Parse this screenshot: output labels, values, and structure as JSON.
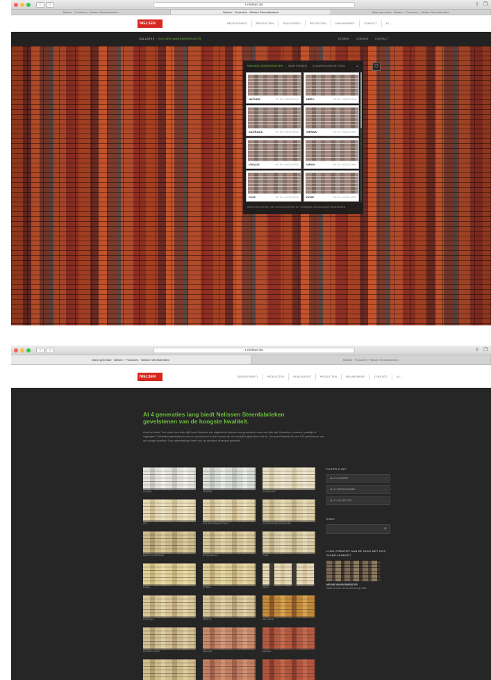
{
  "window1": {
    "url": "r-nielsen.be",
    "tabs": [
      {
        "label": "Nielsen · Producten · Nielsen Steenfabrieken",
        "active": false
      },
      {
        "label": "Nielsen · Producten · Nielsen Steenfabrieken",
        "active": true
      },
      {
        "label": "Wand generator · Nielsen · Producten · Nielsen Steenfabrieken",
        "active": false
      }
    ],
    "logo": "NIELSEN",
    "nav": [
      "BEDRIJFSINFO",
      "PRODUCTEN",
      "REALISATIES",
      "PROJECTEN",
      "NIEUWSBRIEF",
      "CONTACT",
      "NL ⌄"
    ],
    "breadcrumb": {
      "root": "CALLATEX",
      "current": "NIELSEN WANDGENERATOR"
    },
    "subnav": [
      "STENEN",
      "VOEGEN",
      "CONTACT"
    ],
    "panel": {
      "tabs": [
        "NIELSEN STEENSOORTEN",
        "MIJN STENEN",
        "KLEUREN VAN DE VOEG"
      ],
      "cards": [
        {
          "name": "NATURA",
          "code": "WF 65 / HANDVORM"
        },
        {
          "name": "NERO",
          "code": "WF 65 / HANDVORM"
        },
        {
          "name": "SAGRADA",
          "code": "WF 65 / HANDVORM"
        },
        {
          "name": "SIENNA",
          "code": "WF 65 / HANDVORM"
        },
        {
          "name": "VIVALDI",
          "code": "WF 65 / HANDVORM"
        },
        {
          "name": "VIRGO",
          "code": "WF 65 / HANDVORM"
        },
        {
          "name": "FAYE",
          "code": "WF 65 / HANDVORM"
        },
        {
          "name": "ROSE",
          "code": "WF 65 / HANDVORM"
        }
      ],
      "footer_prefix": "●",
      "footer_text": "KIES EEN STEEN, DE VOEGKLEUR EN HET VERBAND OM UW MUUR TE BEKIJKEN"
    }
  },
  "window2": {
    "url": "r-nielsen.be",
    "tabs": [
      {
        "label": "Wand generator · Nielsen · Producten · Nielsen Steenfabrieken",
        "active": true
      },
      {
        "label": "Nielsen · Producten · Nielsen Steenfabrieken",
        "active": false
      }
    ],
    "logo": "NIELSEN",
    "nav": [
      "BEDRIJFSINFO",
      "PRODUCTEN",
      "REALISATIES",
      "PROJECTEN",
      "NIEUWSBRIEF",
      "CONTACT",
      "NL ⌄"
    ],
    "hero_title": "Al 4 generaties lang biedt Nelissen Steenfabrieken gevelstenen van de hoogste kwaliteit.",
    "intro": "Kiest het beste Tool steen voor elke stijl! Vrank Nelissen stel uitgebreide stukken van gevelstenen aan voor elke stijl. Klassieke, moderne, pastelijk of ingetogen? Ontdekken gevelstenen van ons assortiment en een klasse zijn ons bedrijf te gebruiken met de. Ons pand bestaat uit ruim 100 gevelstenen van de hoogste kwaliteit. Onze steenbakkerij heeft zich als architect al bekend gebracht.",
    "products": [
      {
        "name": "ALASKA",
        "c1": "#e6e4dc",
        "c2": "#c9cbc3",
        "c3": "#f2f1ec"
      },
      {
        "name": "ARANDA",
        "c1": "#dcdfd8",
        "c2": "#c3c8c1",
        "c3": "#eceeea"
      },
      {
        "name": "ALASKA WIT",
        "c1": "#e9dec4",
        "c2": "#d6c8a6",
        "c3": "#f0e6cf"
      },
      {
        "name": "AZZ",
        "c1": "#e6d9b3",
        "c2": "#d0c094",
        "c3": "#efe4c2"
      },
      {
        "name": "AZZ GESTRAALDE WALS",
        "c1": "#e2d4ac",
        "c2": "#cbb889",
        "c3": "#ede1bd"
      },
      {
        "name": "AZZ GESTRAALDE BLAUW",
        "c1": "#ddd0a8",
        "c2": "#c6b386",
        "c3": "#eadcb6"
      },
      {
        "name": "BASCO GEBROKEN",
        "c1": "#cdbb8c",
        "c2": "#b09d70",
        "c3": "#dbcb9f"
      },
      {
        "name": "BORGOBELLO",
        "c1": "#d7c79b",
        "c2": "#bca97c",
        "c3": "#e3d5ac"
      },
      {
        "name": "CASA",
        "c1": "#d9cca6",
        "c2": "#bfae84",
        "c3": "#e6dab6"
      },
      {
        "name": "DORA",
        "c1": "#e1d097",
        "c2": "#c9b479",
        "c3": "#ecdca8"
      },
      {
        "name": "DORELI",
        "c1": "#ddcc97",
        "c2": "#c3ad77",
        "c3": "#e8d9a8"
      },
      {
        "name": "EDITH",
        "c1": "#e8d9b6",
        "c2": "#3d3a35",
        "c3": "#d8c69c"
      },
      {
        "name": "FORTUNA",
        "c1": "#d9c79a",
        "c2": "#bea87a",
        "c3": "#e6d6ab"
      },
      {
        "name": "GROLIO",
        "c1": "#d6c497",
        "c2": "#baa37a",
        "c3": "#e2d2a9"
      },
      {
        "name": "HALLESTE",
        "c1": "#c48a3a",
        "c2": "#8d5a24",
        "c3": "#d9a552"
      },
      {
        "name": "HERMES GRIJS",
        "c1": "#d2bf92",
        "c2": "#b59f74",
        "c3": "#ded0a6"
      },
      {
        "name": "MALAGA",
        "c1": "#c88a6a",
        "c2": "#a86a50",
        "c3": "#d49b7c"
      },
      {
        "name": "MAGMA",
        "c1": "#b55a40",
        "c2": "#8c3d2c",
        "c3": "#c56c50"
      },
      {
        "name": "",
        "c1": "#d2bd8c",
        "c2": "#b3a070",
        "c3": "#e0cd9f"
      },
      {
        "name": "",
        "c1": "#c47f60",
        "c2": "#a3604a",
        "c3": "#d09374"
      },
      {
        "name": "",
        "c1": "#b4553c",
        "c2": "#8a3a2a",
        "c3": "#c4674c"
      }
    ],
    "sidebar": {
      "filter_heading": "FILTER LIJST",
      "filters": [
        "ALLE KLEUREN",
        "ALLE STEENVORMEN",
        "ALLE COLLECTIES"
      ],
      "search_heading": "ZOEK",
      "search_value": "",
      "promo_title": "U WIL CREATIEF AAN DE SLAG MET ONS RUIME AANBOD?",
      "promo_sub": "NIEUWE WANDGENERATOR",
      "promo_sub2": "Maak de muur van uw dromen op maat"
    }
  },
  "colors": {
    "accent": "#7ac143",
    "brand": "#d7261d",
    "dark": "#262626"
  }
}
